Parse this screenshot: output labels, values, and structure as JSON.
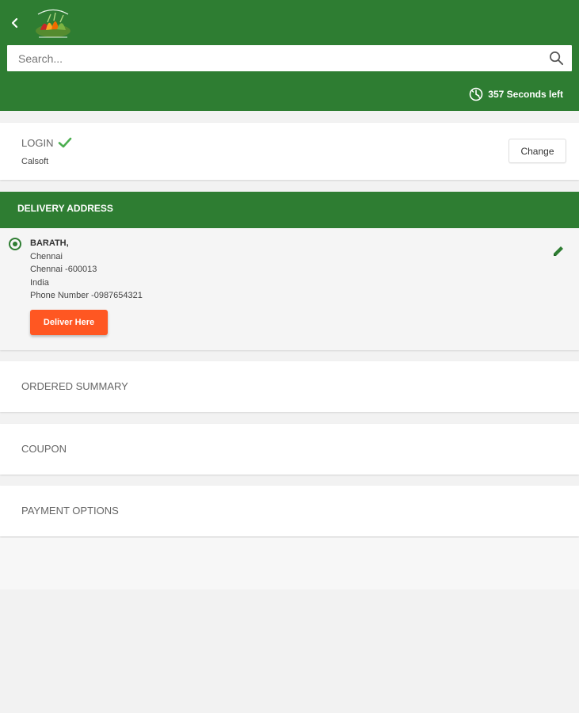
{
  "header": {
    "background": "#2e7d32",
    "search_placeholder": "Search...",
    "timer_text": "357 Seconds left"
  },
  "login": {
    "title": "LOGIN",
    "user": "Calsoft",
    "change_label": "Change"
  },
  "delivery": {
    "title": "DELIVERY ADDRESS",
    "address": {
      "name": "BARATH,",
      "line1": "Chennai",
      "line2": "Chennai -600013",
      "country": "India",
      "phone": "Phone Number -0987654321"
    },
    "deliver_label": "Deliver Here",
    "deliver_color": "#ff5722"
  },
  "sections": {
    "ordered_summary": "ORDERED SUMMARY",
    "coupon": "COUPON",
    "payment_options": "PAYMENT OPTIONS"
  },
  "icons": {
    "back": "chevron-left-icon",
    "search": "search-icon",
    "timer": "timer-icon",
    "check": "check-icon",
    "edit": "pencil-icon"
  }
}
